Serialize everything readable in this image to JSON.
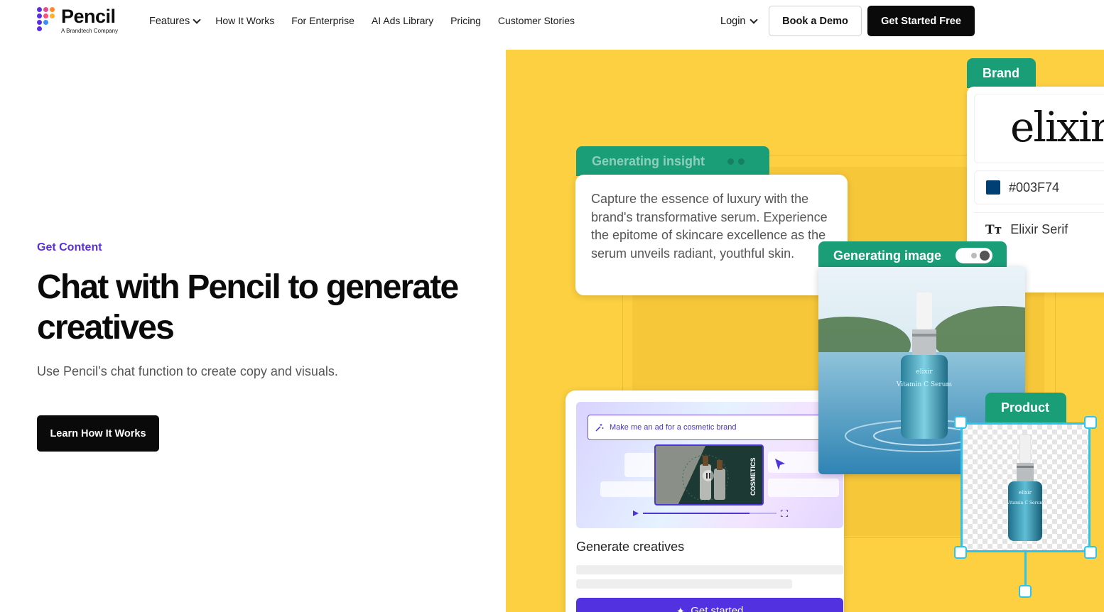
{
  "brand": {
    "name": "Pencil",
    "tagline": "A Brandtech Company"
  },
  "nav": {
    "links": [
      "Features",
      "How It Works",
      "For Enterprise",
      "AI Ads Library",
      "Pricing",
      "Customer Stories"
    ],
    "login": "Login",
    "book_demo": "Book a Demo",
    "get_started": "Get Started Free"
  },
  "hero": {
    "eyebrow": "Get Content",
    "headline": "Chat with Pencil to generate creatives",
    "subhead": "Use Pencil’s chat function to create copy and visuals.",
    "cta": "Learn How It Works"
  },
  "illustration": {
    "insight_tab": "Generating insight",
    "insight_text": "Capture the essence of luxury with the brand's transformative serum. Experience the epitome of skincare excellence as the serum unveils radiant, youthful skin.",
    "brand_tab": "Brand",
    "brand_logo": "elixir",
    "brand_color_hex": "#003F74",
    "brand_font": "Elixir Serif",
    "image_tab": "Generating image",
    "product_tab": "Product",
    "chat_prompt": "Make me an ad for a cosmetic brand",
    "video_label": "COSMETICS",
    "generate_title": "Generate creatives",
    "generate_cta": "Get started",
    "bottle_brand": "elixir",
    "bottle_product": "Vitamin C Serum"
  },
  "colors": {
    "accent": "#5b2ee0",
    "panel_bg": "#fdd041",
    "tab_green": "#1a9e78",
    "selection_blue": "#29c4ef"
  }
}
